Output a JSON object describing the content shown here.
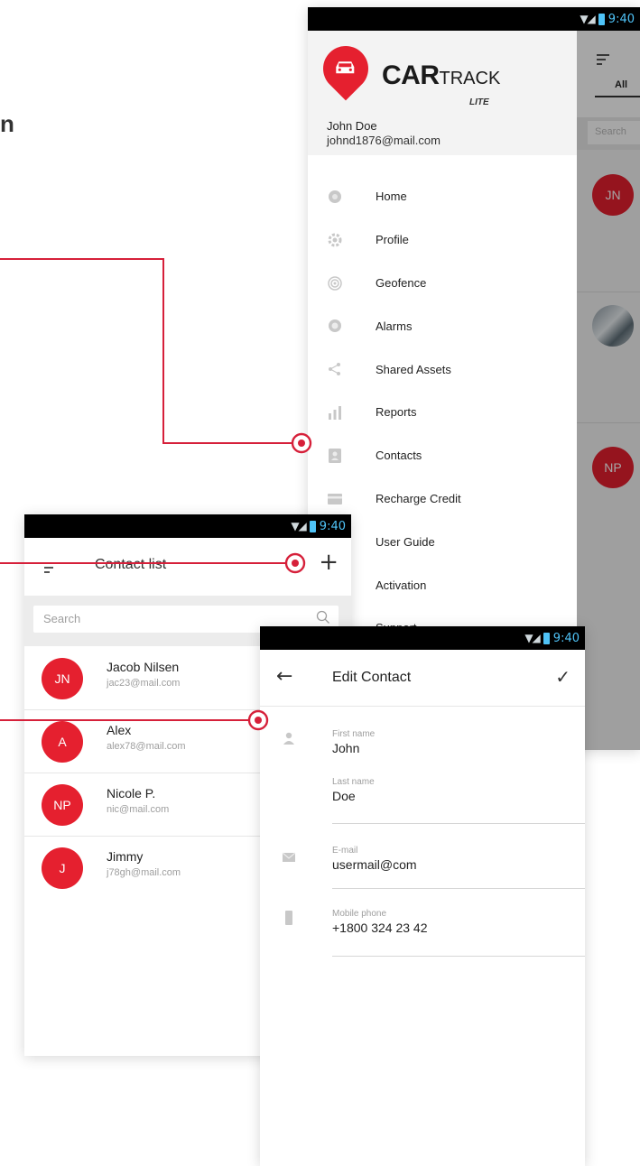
{
  "fragment": {
    "text": "n"
  },
  "status_bar": {
    "time": "9:40"
  },
  "colors": {
    "accent": "#e5202f",
    "status_time": "#4fc3f7"
  },
  "drawer": {
    "logo": {
      "brand_bold": "CAR",
      "brand_light": "TRACK",
      "edition": "LITE"
    },
    "user": {
      "name": "John Doe",
      "email": "johnd1876@mail.com"
    },
    "menu": [
      {
        "label": "Home",
        "icon": "home-icon"
      },
      {
        "label": "Profile",
        "icon": "gear-icon"
      },
      {
        "label": "Geofence",
        "icon": "geofence-icon"
      },
      {
        "label": "Alarms",
        "icon": "alarm-icon"
      },
      {
        "label": "Shared Assets",
        "icon": "share-icon"
      },
      {
        "label": "Reports",
        "icon": "bar-chart-icon"
      },
      {
        "label": "Contacts",
        "icon": "contacts-icon"
      },
      {
        "label": "Recharge Credit",
        "icon": "credit-card-icon"
      },
      {
        "label": "User Guide",
        "icon": "guide-icon"
      },
      {
        "label": "Activation",
        "icon": "activation-icon"
      },
      {
        "label": "Support",
        "icon": "support-icon"
      }
    ],
    "background": {
      "tab_label": "All",
      "search_placeholder": "Search",
      "avatars": [
        "JN",
        "NP"
      ]
    }
  },
  "contact_list": {
    "title": "Contact list",
    "add_label": "+",
    "search_placeholder": "Search",
    "contacts": [
      {
        "initials": "JN",
        "name": "Jacob Nilsen",
        "email": "jac23@mail.com"
      },
      {
        "initials": "A",
        "name": "Alex",
        "email": "alex78@mail.com"
      },
      {
        "initials": "NP",
        "name": "Nicole P.",
        "email": "nic@mail.com"
      },
      {
        "initials": "J",
        "name": "Jimmy",
        "email": "j78gh@mail.com"
      }
    ]
  },
  "edit_contact": {
    "back_label": "←",
    "title": "Edit Contact",
    "save_label": "✓",
    "fields": [
      {
        "label": "First name",
        "value": "John"
      },
      {
        "label": "Last name",
        "value": "Doe"
      },
      {
        "label": "E-mail",
        "value": "usermail@com"
      },
      {
        "label": "Mobile phone",
        "value": "+1800 324 23 42"
      }
    ]
  }
}
